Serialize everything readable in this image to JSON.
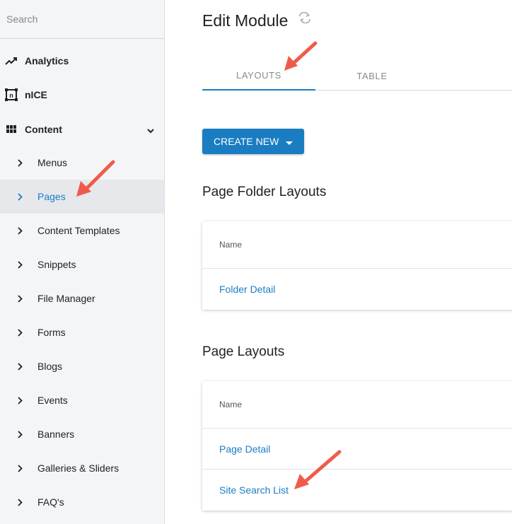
{
  "sidebar": {
    "search_placeholder": "Search",
    "top_items": [
      {
        "label": "Analytics",
        "icon": "trending-up-icon"
      },
      {
        "label": "nICE",
        "icon": "nice-logo-icon"
      },
      {
        "label": "Content",
        "icon": "grid-icon",
        "expanded": true
      }
    ],
    "sub_items": [
      {
        "label": "Menus"
      },
      {
        "label": "Pages",
        "active": true
      },
      {
        "label": "Content Templates"
      },
      {
        "label": "Snippets"
      },
      {
        "label": "File Manager"
      },
      {
        "label": "Forms"
      },
      {
        "label": "Blogs"
      },
      {
        "label": "Events"
      },
      {
        "label": "Banners"
      },
      {
        "label": "Galleries & Sliders"
      },
      {
        "label": "FAQ's"
      }
    ]
  },
  "main": {
    "title": "Edit Module",
    "tabs": [
      {
        "label": "LAYOUTS",
        "active": true
      },
      {
        "label": "TABLE",
        "active": false
      }
    ],
    "create_button": "CREATE NEW",
    "sections": [
      {
        "heading": "Page Folder Layouts",
        "column_header": "Name",
        "rows": [
          "Folder Detail"
        ]
      },
      {
        "heading": "Page Layouts",
        "column_header": "Name",
        "rows": [
          "Page Detail",
          "Site Search List"
        ]
      }
    ]
  },
  "colors": {
    "accent": "#1a7dc2",
    "annotation_arrow": "#ef5b4b",
    "sidebar_bg": "#f4f5f7"
  }
}
